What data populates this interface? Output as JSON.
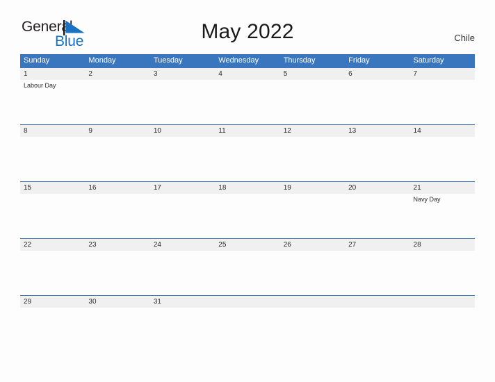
{
  "brand": {
    "name_part1": "General",
    "name_part2": "Blue",
    "flag_icon": "blue-triangle-flag-icon",
    "accent_color": "#1a72c4"
  },
  "header": {
    "title": "May 2022",
    "country": "Chile"
  },
  "colors": {
    "header_blue": "#3a76bd",
    "date_band_gray": "#f0f0f0",
    "page_background": "#fdfdfd",
    "text_dark": "#2b2b2b"
  },
  "calendar": {
    "month": "May",
    "year": "2022",
    "weekday_headers": [
      "Sunday",
      "Monday",
      "Tuesday",
      "Wednesday",
      "Thursday",
      "Friday",
      "Saturday"
    ],
    "weeks": [
      {
        "days": [
          {
            "date": "1",
            "events": [
              "Labour Day"
            ]
          },
          {
            "date": "2",
            "events": []
          },
          {
            "date": "3",
            "events": []
          },
          {
            "date": "4",
            "events": []
          },
          {
            "date": "5",
            "events": []
          },
          {
            "date": "6",
            "events": []
          },
          {
            "date": "7",
            "events": []
          }
        ]
      },
      {
        "days": [
          {
            "date": "8",
            "events": []
          },
          {
            "date": "9",
            "events": []
          },
          {
            "date": "10",
            "events": []
          },
          {
            "date": "11",
            "events": []
          },
          {
            "date": "12",
            "events": []
          },
          {
            "date": "13",
            "events": []
          },
          {
            "date": "14",
            "events": []
          }
        ]
      },
      {
        "days": [
          {
            "date": "15",
            "events": []
          },
          {
            "date": "16",
            "events": []
          },
          {
            "date": "17",
            "events": []
          },
          {
            "date": "18",
            "events": []
          },
          {
            "date": "19",
            "events": []
          },
          {
            "date": "20",
            "events": []
          },
          {
            "date": "21",
            "events": [
              "Navy Day"
            ]
          }
        ]
      },
      {
        "days": [
          {
            "date": "22",
            "events": []
          },
          {
            "date": "23",
            "events": []
          },
          {
            "date": "24",
            "events": []
          },
          {
            "date": "25",
            "events": []
          },
          {
            "date": "26",
            "events": []
          },
          {
            "date": "27",
            "events": []
          },
          {
            "date": "28",
            "events": []
          }
        ]
      },
      {
        "days": [
          {
            "date": "29",
            "events": []
          },
          {
            "date": "30",
            "events": []
          },
          {
            "date": "31",
            "events": []
          },
          {
            "date": "",
            "events": []
          },
          {
            "date": "",
            "events": []
          },
          {
            "date": "",
            "events": []
          },
          {
            "date": "",
            "events": []
          }
        ]
      }
    ]
  }
}
